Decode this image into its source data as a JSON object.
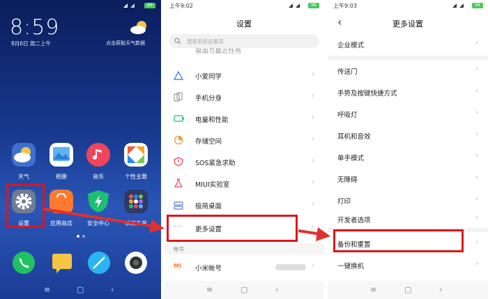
{
  "phone1": {
    "clock": "8:59",
    "date": "8月6日 周二上午",
    "weather_hint": "点击获取天气数据",
    "battery": "96",
    "apps_row1": [
      {
        "label": "天气",
        "icon": "weather-icon"
      },
      {
        "label": "相册",
        "icon": "gallery-icon"
      },
      {
        "label": "音乐",
        "icon": "music-icon"
      },
      {
        "label": "个性主题",
        "icon": "themes-icon"
      }
    ],
    "apps_row2": [
      {
        "label": "设置",
        "icon": "settings-gear-icon"
      },
      {
        "label": "应用商店",
        "icon": "app-store-icon"
      },
      {
        "label": "安全中心",
        "icon": "security-shield-icon"
      },
      {
        "label": "系统工具",
        "icon": "system-tools-icon"
      }
    ],
    "dock": [
      "phone-icon",
      "messages-icon",
      "browser-icon",
      "camera-icon"
    ]
  },
  "phone2": {
    "time": "上午9:02",
    "battery": "96",
    "title": "设置",
    "search_placeholder": "搜索系统设置项",
    "partial_item": "桌面与最近任务",
    "items": [
      {
        "label": "小爱同学",
        "icon": "xiaoai-icon"
      },
      {
        "label": "手机分身",
        "icon": "dual-phone-icon"
      },
      {
        "label": "电量和性能",
        "icon": "battery-icon"
      },
      {
        "label": "存储空间",
        "icon": "storage-icon"
      },
      {
        "label": "SOS紧急求助",
        "icon": "sos-icon"
      },
      {
        "label": "MIUI实验室",
        "icon": "lab-flask-icon"
      },
      {
        "label": "极简桌面",
        "icon": "minimal-desktop-icon"
      },
      {
        "label": "更多设置",
        "icon": "more-dots-icon"
      }
    ],
    "section_account": "帐号",
    "account_item": "小米帐号",
    "account_badge": "MI"
  },
  "phone3": {
    "time": "上午9:03",
    "battery": "96",
    "title": "更多设置",
    "items": [
      "企业模式",
      "传送门",
      "手势及按键快捷方式",
      "呼吸灯",
      "耳机和音效",
      "单手模式",
      "无障碍",
      "打印",
      "开发者选项",
      "备份和重置",
      "一键换机"
    ]
  },
  "colors": {
    "highlight_red": "#e0141b",
    "battery_green": "#48c95b",
    "arrow_red": "#e03030"
  }
}
